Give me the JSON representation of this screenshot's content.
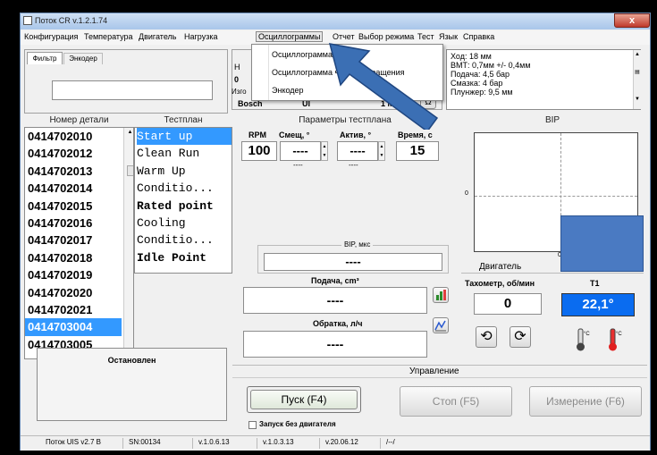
{
  "window": {
    "title": "Поток CR v.1.2.1.74",
    "close_label": "x"
  },
  "menu": [
    "Конфигурация",
    "Температура",
    "Двигатель",
    "Нагрузка",
    "Осциллограммы",
    "Отчет",
    "Выбор режима",
    "Тест",
    "Язык",
    "Справка"
  ],
  "dropdown": [
    "Осциллограмма",
    "Осциллограмма частоты вращения",
    "Энкодер"
  ],
  "filter": {
    "tabs": [
      "Фильтр",
      "Энкодер"
    ],
    "value": ""
  },
  "mid_box": {
    "h": "Н",
    "zero": "0",
    "izgo": "Изго",
    "bosch": "Bosch",
    "ui": "UI",
    "mhz": "1 МГ",
    "omega": "Ω"
  },
  "info_lines": [
    "Ход: 18 мм",
    "ВМТ: 0,7мм +/- 0,4мм",
    "Подача: 4,5 бар",
    "Смазка: 4 бар",
    "Плунжер: 9,5 мм"
  ],
  "parts": {
    "header": "Номер детали",
    "items": [
      "0414702010",
      "0414702012",
      "0414702013",
      "0414702014",
      "0414702015",
      "0414702016",
      "0414702017",
      "0414702018",
      "0414702019",
      "0414702020",
      "0414702021",
      "0414703004",
      "0414703005"
    ],
    "selected_index": 11
  },
  "testplan": {
    "header": "Тестплан",
    "items": [
      "Start up",
      "Clean Run",
      "Warm Up",
      "Conditio...",
      "Rated point",
      "Cooling",
      "Conditio...",
      "Idle Point"
    ]
  },
  "params": {
    "header": "Параметры тестплана",
    "rpm_label": "RPM",
    "shift_label": "Смещ, °",
    "active_label": "Актив, °",
    "time_label": "Время, с",
    "rpm_value": "100",
    "shift_value": "----",
    "active_value": "----",
    "time_value": "15",
    "sub_shift": "----",
    "sub_active": "----",
    "bip_label": "BIP, мкс",
    "bip_value": "----"
  },
  "flow": {
    "supply_label": "Подача, cm³",
    "supply_value": "----",
    "return_label": "Обратка, л/ч",
    "return_value": "----"
  },
  "bip_chart": {
    "header": "BIP",
    "y_zero": "0",
    "x_zero": "0"
  },
  "engine": {
    "header": "Двигатель",
    "tacho_label": "Тахометр, об/мин",
    "tacho_value": "0",
    "t1_label": "T1",
    "t1_value": "22,1°",
    "t1_bg": "#0a6cf0"
  },
  "state": {
    "status_text": "Остановлен"
  },
  "control": {
    "header": "Управление",
    "start": "Пуск (F4)",
    "stop": "Стоп (F5)",
    "measure": "Измерение (F6)",
    "no_engine": "Запуск без двигателя"
  },
  "statusbar": [
    "Поток UIS v2.7 B",
    "SN:00134",
    "v.1.0.6.13",
    "v.1.0.3.13",
    "v.20.06.12",
    "/--/"
  ],
  "colors": {
    "accent": "#3399ff",
    "arrow": "#3b6fb4",
    "blue_box": "#4a7ac2"
  }
}
